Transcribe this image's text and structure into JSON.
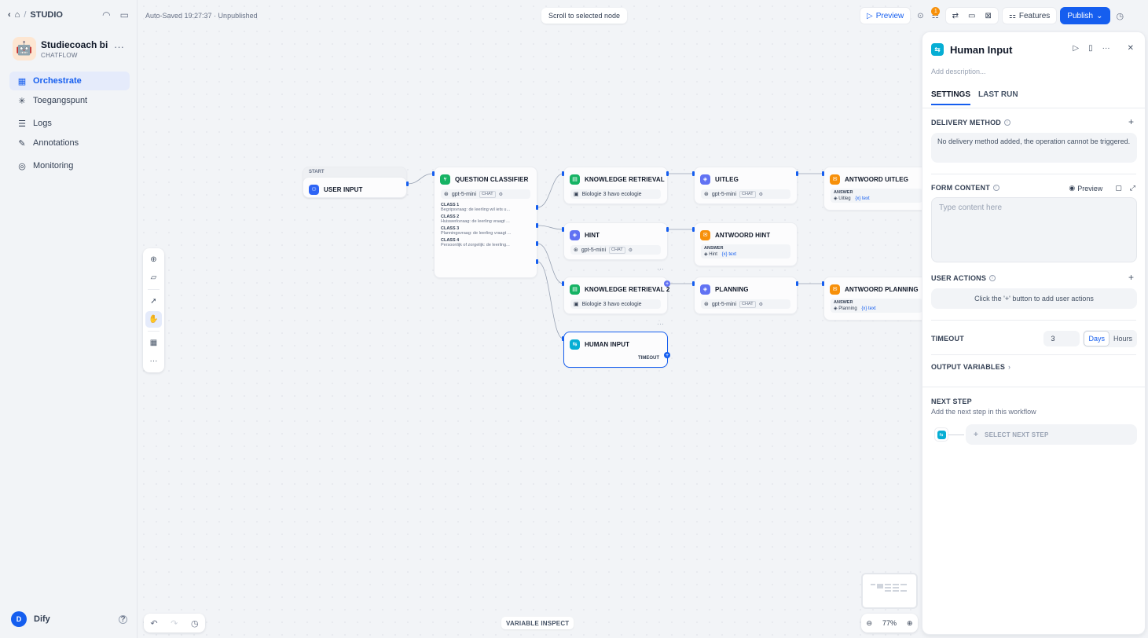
{
  "breadcrumb": {
    "studio": "STUDIO"
  },
  "app": {
    "name": "Studiecoach bi...",
    "type": "CHATFLOW",
    "emoji": "🤖"
  },
  "nav": [
    {
      "label": "Orchestrate",
      "icon": "orchestrate-icon"
    },
    {
      "label": "Toegangspunt",
      "icon": "access-point-icon"
    },
    {
      "label": "Logs",
      "icon": "logs-icon"
    },
    {
      "label": "Annotations",
      "icon": "annotations-icon"
    },
    {
      "label": "Monitoring",
      "icon": "monitoring-icon"
    }
  ],
  "user": {
    "initial": "D",
    "name": "Dify"
  },
  "canvas": {
    "autosave": "Auto-Saved 19:27:37 · Unpublished",
    "scroll_to_selected": "Scroll to selected node",
    "variable_inspect": "VARIABLE INSPECT",
    "zoom": "77%"
  },
  "topbar": {
    "preview": "Preview",
    "badge": "1",
    "features": "Features",
    "publish": "Publish"
  },
  "nodes": {
    "start_label": "START",
    "user_input": "USER INPUT",
    "question_classifier": {
      "title": "QUESTION CLASSIFIER",
      "model": "gpt-5-mini",
      "mode": "CHAT",
      "classes": [
        {
          "label": "CLASS 1",
          "desc": "Begripsvraag: de leerling wil iets u..."
        },
        {
          "label": "CLASS 2",
          "desc": "Huiswerkvraag: de leerling vraagt ..."
        },
        {
          "label": "CLASS 3",
          "desc": "Planningsvraag: de leerling vraagt ..."
        },
        {
          "label": "CLASS 4",
          "desc": "Persoonlijk of zorgelijk: de leerling..."
        }
      ]
    },
    "knowledge_retrieval": {
      "title": "KNOWLEDGE RETRIEVAL",
      "dataset": "Biologie 3 havo ecologie"
    },
    "uitleg": {
      "title": "UITLEG",
      "model": "gpt-5-mini",
      "mode": "CHAT"
    },
    "antwoord_uitleg": {
      "title": "ANTWOORD UITLEG",
      "answer_label": "ANSWER",
      "src": "Uitleg",
      "var": "text"
    },
    "hint": {
      "title": "HINT",
      "model": "gpt-5-mini",
      "mode": "CHAT"
    },
    "antwoord_hint": {
      "title": "ANTWOORD HINT",
      "answer_label": "ANSWER",
      "src": "Hint",
      "var": "text"
    },
    "knowledge_retrieval_2": {
      "title": "KNOWLEDGE RETRIEVAL 2",
      "dataset": "Biologie 3 havo ecologie"
    },
    "planning": {
      "title": "PLANNING",
      "model": "gpt-5-mini",
      "mode": "CHAT"
    },
    "antwoord_planning": {
      "title": "ANTWOORD PLANNING",
      "answer_label": "ANSWER",
      "src": "Planning",
      "var": "text"
    },
    "human_input": {
      "title": "HUMAN INPUT",
      "timeout": "TIMEOUT"
    }
  },
  "panel": {
    "title": "Human Input",
    "description_placeholder": "Add description...",
    "tabs": [
      "SETTINGS",
      "LAST RUN"
    ],
    "delivery_method": {
      "label": "DELIVERY METHOD",
      "empty": "No delivery method added, the operation cannot be triggered."
    },
    "form_content": {
      "label": "FORM CONTENT",
      "preview": "Preview",
      "placeholder": "Type content here"
    },
    "user_actions": {
      "label": "USER ACTIONS",
      "empty": "Click the '+' button to add user actions"
    },
    "timeout": {
      "label": "TIMEOUT",
      "value": "3",
      "units": [
        "Days",
        "Hours"
      ],
      "selected_unit": "Days"
    },
    "output_variables": {
      "label": "OUTPUT VARIABLES"
    },
    "next_step": {
      "label": "NEXT STEP",
      "hint": "Add the next step in this workflow",
      "button": "SELECT NEXT STEP"
    }
  },
  "colors": {
    "accent": "#155eef",
    "llm": "#6172f3",
    "answer": "#f79009",
    "knowledge": "#16b364",
    "human_input": "#06aed4"
  }
}
